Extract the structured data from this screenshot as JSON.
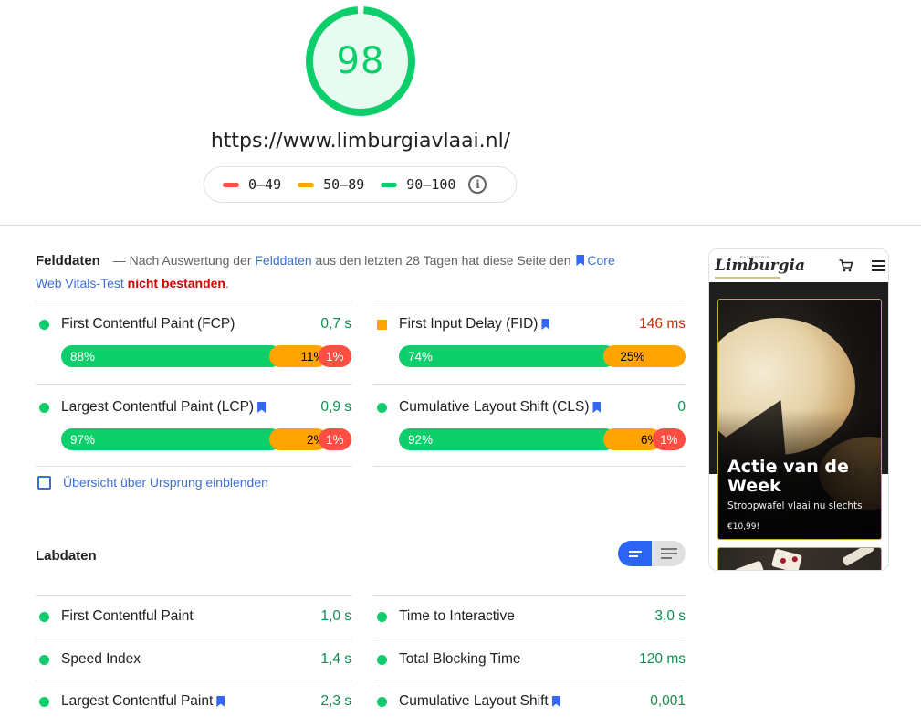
{
  "score": {
    "value": "98",
    "fraction": 0.98,
    "color": "#0cce6b",
    "bg_color": "#e8fbf1"
  },
  "url": "https://www.limburgiavlaai.nl/",
  "legend": [
    {
      "range": "0–49",
      "color": "#ff4e42"
    },
    {
      "range": "50–89",
      "color": "#ffa400"
    },
    {
      "range": "90–100",
      "color": "#0cce6b"
    }
  ],
  "legend_info_icon": "info-icon",
  "field_data": {
    "title": "Felddaten",
    "desc_prefix": "— Nach Auswertung der",
    "desc_link": "Felddaten",
    "desc_middle": "aus den letzten 28 Tagen hat diese Seite den",
    "cwv_link_1": "Core",
    "cwv_link_2": "Web Vitals-Test",
    "result": "nicht bestanden",
    "period": ".",
    "metrics": [
      {
        "label": "First Contentful Paint (FCP)",
        "value": "0,7 s",
        "status": "good",
        "bookmark": false,
        "distribution": {
          "good": "88%",
          "average": "11%",
          "poor": "1%"
        },
        "dist_values": [
          88,
          11,
          1
        ]
      },
      {
        "label": "First Input Delay (FID)",
        "value": "146 ms",
        "status": "average",
        "bookmark": true,
        "distribution": {
          "good": "74%",
          "average": "25%",
          "poor": ""
        },
        "dist_values": [
          74,
          25,
          1
        ]
      },
      {
        "label": "Largest Contentful Paint (LCP)",
        "value": "0,9 s",
        "status": "good",
        "bookmark": true,
        "distribution": {
          "good": "97%",
          "average": "2%",
          "poor": "1%"
        },
        "dist_values": [
          97,
          2,
          1
        ]
      },
      {
        "label": "Cumulative Layout Shift (CLS)",
        "value": "0",
        "status": "good",
        "bookmark": true,
        "distribution": {
          "good": "92%",
          "average": "6%",
          "poor": "1%"
        },
        "dist_values": [
          92,
          6,
          1
        ]
      }
    ],
    "origin_checkbox_label": "Übersicht über Ursprung einblenden",
    "origin_checked": false
  },
  "lab_data": {
    "title": "Labdaten",
    "view_toggle": {
      "active": "compact",
      "options": [
        "compact-view",
        "list-view"
      ]
    },
    "metrics": [
      {
        "label": "First Contentful Paint",
        "value": "1,0 s",
        "status": "good",
        "bookmark": false
      },
      {
        "label": "Time to Interactive",
        "value": "3,0 s",
        "status": "good",
        "bookmark": false
      },
      {
        "label": "Speed Index",
        "value": "1,4 s",
        "status": "good",
        "bookmark": false
      },
      {
        "label": "Total Blocking Time",
        "value": "120 ms",
        "status": "good",
        "bookmark": false
      },
      {
        "label": "Largest Contentful Paint",
        "value": "2,3 s",
        "status": "good",
        "bookmark": true
      },
      {
        "label": "Cumulative Layout Shift",
        "value": "0,001",
        "status": "good",
        "bookmark": true
      }
    ]
  },
  "preview": {
    "brand_small": "PATISSERIE",
    "brand": "Limburgia",
    "cart_icon": "cart-icon",
    "menu_icon": "hamburger-menu-icon",
    "card_title": "Actie van de Week",
    "card_subtitle": "Stroopwafel vlaai nu slechts",
    "card_price": "€10,99!"
  },
  "colors": {
    "good": "#0cce6b",
    "average": "#ffa400",
    "poor": "#ff4e42",
    "good_text": "#0d8f4f",
    "average_text": "#c33300",
    "link": "#3c6fd6",
    "fail_text": "#d50000",
    "toggle_active": "#2b63f5"
  }
}
